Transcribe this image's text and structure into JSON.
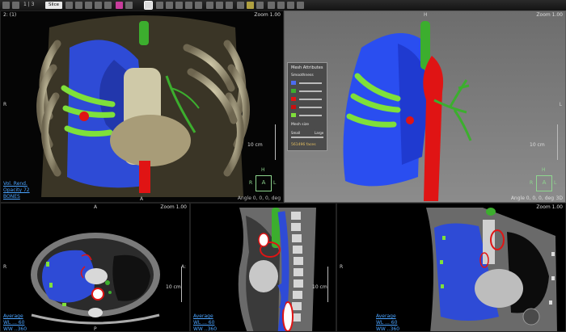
{
  "toolbar": {
    "view_counter": "1 | 3",
    "slab_label": "Slice"
  },
  "colors": {
    "lung": "#2e4bd6",
    "aorta": "#e01414",
    "airway": "#3cae2e",
    "rib_highlight": "#7fe03a",
    "link": "#4aa3ff"
  },
  "tl": {
    "series": "2: (1)",
    "zoom": "Zoom 1.00",
    "mode": "Vol. Rend.",
    "opacity": "Opacity 72",
    "preset": "BONES",
    "left_label": "R",
    "bottom_label": "A",
    "scale": "10 cm",
    "cube": {
      "top": "H",
      "center": "A",
      "left": "R",
      "right": "L"
    },
    "angle": "Angle 0, 0, 0, deg"
  },
  "tr": {
    "zoom": "Zoom 1.00",
    "top_label": "H",
    "right_label": "L",
    "scale": "10 cm",
    "cube": {
      "top": "H",
      "center": "A",
      "left": "R",
      "right": "L"
    },
    "angle": "Angle 0, 0, 0, deg",
    "angle_suffix": "3D"
  },
  "mesh": {
    "title": "Mesh Attributes",
    "smoothness": "Smoothness",
    "mesh_size": "Mesh size",
    "small": "Small",
    "large": "Large",
    "faces": "561496 faces"
  },
  "bl": {
    "top_label": "A",
    "zoom": "Zoom 1.00",
    "left_label": "R",
    "right_label": "A:",
    "scale": "10 cm",
    "bottom_label": "P",
    "mode": "Average",
    "wl": "WL ... 60",
    "ww": "WW ..360"
  },
  "bm": {
    "scale": "10 cm",
    "mode": "Average",
    "wl": "WL ... 60",
    "ww": "WW ..360"
  },
  "br": {
    "zoom": "Zoom 1.00",
    "left_label": "R",
    "mode": "Average",
    "wl": "WL ... 60",
    "ww": "WW ..360"
  }
}
